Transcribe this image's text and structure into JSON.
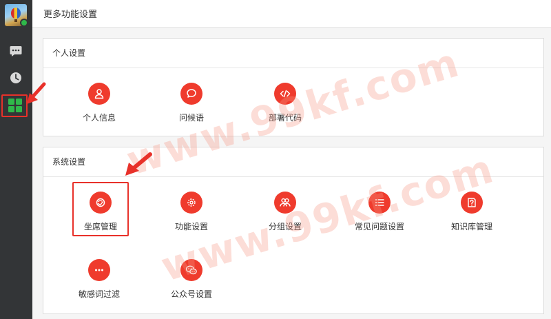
{
  "header": {
    "title": "更多功能设置"
  },
  "sidebar": {
    "items": [
      {
        "name": "chat",
        "icon": "chat-bubble-icon"
      },
      {
        "name": "history",
        "icon": "clock-icon"
      },
      {
        "name": "more",
        "icon": "grid-icon",
        "active": true
      }
    ],
    "status_color": "#2fb84a"
  },
  "personal": {
    "title": "个人设置",
    "items": [
      {
        "label": "个人信息",
        "icon": "user-icon"
      },
      {
        "label": "问候语",
        "icon": "speech-bubble-icon"
      },
      {
        "label": "部署代码",
        "icon": "code-icon"
      }
    ]
  },
  "system": {
    "title": "系统设置",
    "items": [
      {
        "label": "坐席管理",
        "icon": "agent-icon",
        "highlighted": true
      },
      {
        "label": "功能设置",
        "icon": "gear-icon"
      },
      {
        "label": "分组设置",
        "icon": "group-icon"
      },
      {
        "label": "常见问题设置",
        "icon": "list-icon"
      },
      {
        "label": "知识库管理",
        "icon": "knowledge-icon"
      },
      {
        "label": "敏感词过滤",
        "icon": "more-dots-icon"
      },
      {
        "label": "公众号设置",
        "icon": "wechat-icon"
      }
    ]
  },
  "watermark": {
    "text": "www.99kf.com"
  },
  "colors": {
    "accent": "#ef3b2d",
    "sidebar": "#333537",
    "annotation": "#e8312a"
  }
}
